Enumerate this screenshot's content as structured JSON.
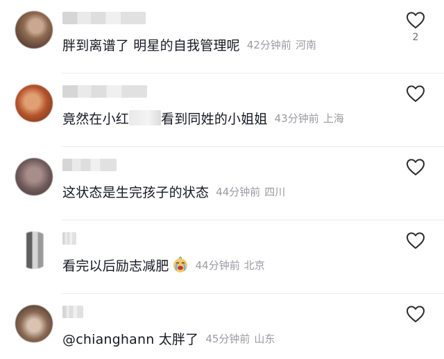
{
  "comments": [
    {
      "text": "胖到离谱了 明星的自我管理呢",
      "time": "42分钟前",
      "location": "河南",
      "likes": "2",
      "avatar_colors": [
        "#5a4035",
        "#c9a891",
        "#8f6b52"
      ]
    },
    {
      "text_before": "竟然在小红",
      "text_after": "看到同姓的小姐姐",
      "time": "43分钟前",
      "location": "上海",
      "avatar_colors": [
        "#b5532b",
        "#e0a074",
        "#7a3a20"
      ]
    },
    {
      "text": "这状态是生完孩子的状态",
      "time": "44分钟前",
      "location": "四川",
      "avatar_colors": [
        "#6e5a5a",
        "#a88e8a",
        "#4a3c3c"
      ]
    },
    {
      "text": "看完以后励志减肥",
      "time": "44分钟前",
      "location": "北京",
      "emoji": "crying-face-emoji",
      "avatar_colors": [
        "#9a9a9a",
        "#d6d6d6",
        "#5f5f5f"
      ]
    },
    {
      "text": "@chianghann 太胖了",
      "time": "45分钟前",
      "location": "山东",
      "avatar_colors": [
        "#8a6a55",
        "#d9c3b0",
        "#4f3a2e"
      ]
    }
  ],
  "ui": {
    "like_icon": "heart-outline-icon",
    "divider_color": "#ececec"
  }
}
